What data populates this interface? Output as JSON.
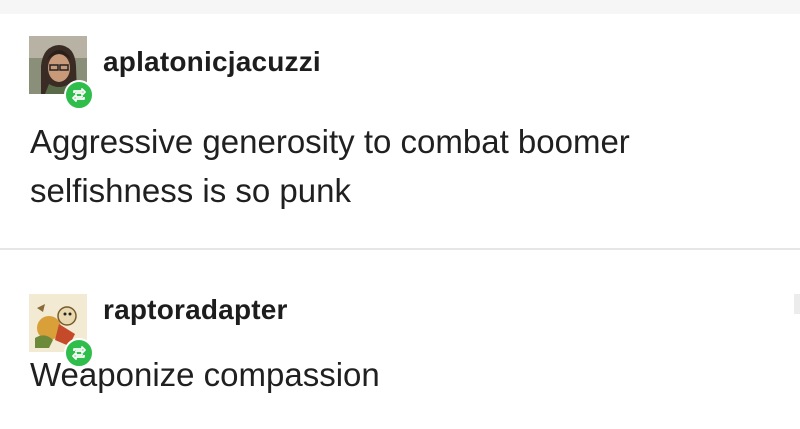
{
  "posts": [
    {
      "username": "aplatonicjacuzzi",
      "body_lines": [
        "Aggressive generosity to combat boomer",
        "selfishness is so punk"
      ],
      "avatar_icon": "user-avatar-icon",
      "badge_icon": "reblog-icon"
    },
    {
      "username": "raptoradapter",
      "body_lines": [
        "Weaponize compassion"
      ],
      "avatar_icon": "user-avatar-icon",
      "badge_icon": "reblog-icon"
    }
  ],
  "colors": {
    "reblog_badge": "#2fbe4c",
    "text": "#202020",
    "divider": "#e6e6e6"
  }
}
